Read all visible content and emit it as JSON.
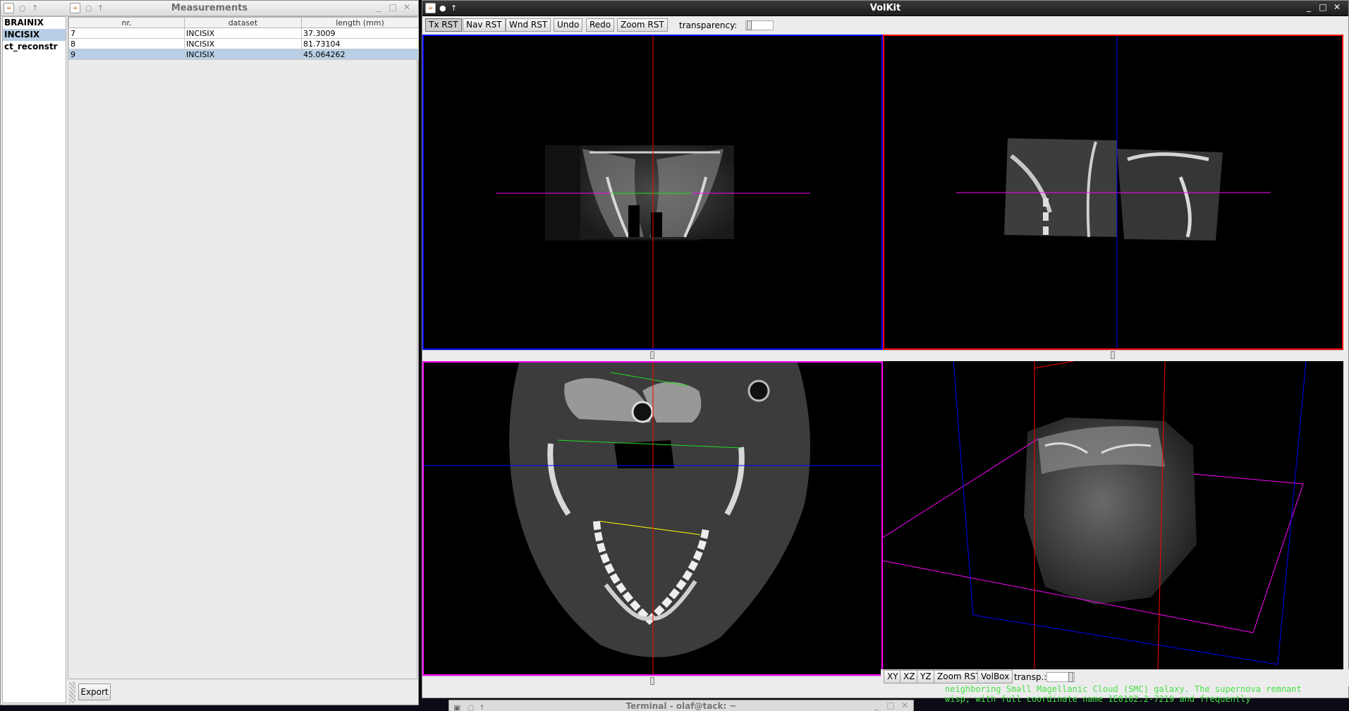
{
  "measurements_window": {
    "title": "Measurements",
    "datasets": [
      "BRAINIX",
      "INCISIX",
      "ct_reconstr"
    ],
    "selected_dataset": "INCISIX",
    "columns": [
      "nr.",
      "dataset",
      "length (mm)"
    ],
    "rows": [
      {
        "nr": "7",
        "dataset": "INCISIX",
        "length": "37.3009"
      },
      {
        "nr": "8",
        "dataset": "INCISIX",
        "length": "81.73104"
      },
      {
        "nr": "9",
        "dataset": "INCISIX",
        "length": "45.064262"
      }
    ],
    "selected_row_nr": "9",
    "export_label": "Export"
  },
  "volkit_window": {
    "title": "VolKit",
    "toolbar": {
      "tx_rst": "Tx RST",
      "nav_rst": "Nav RST",
      "wnd_rst": "Wnd RST",
      "undo": "Undo",
      "redo": "Redo",
      "zoom_rst": "Zoom RST",
      "transparency_label": "transparency:"
    },
    "view3d_toolbar": {
      "xy": "XY",
      "xz": "XZ",
      "yz": "YZ",
      "zoom_rst": "Zoom RST",
      "volbox": "VolBox",
      "transp_label": "transp.:"
    },
    "view_colors": {
      "axial_frame": "#0000ff",
      "sagittal_frame": "#ff0000",
      "coronal_frame": "#ff00ff",
      "crosshair_red": "#ff0000",
      "crosshair_blue": "#0000ff",
      "crosshair_magenta": "#ff00ff",
      "measure_green": "#22dd22",
      "measure_yellow": "#ffff00"
    }
  },
  "terminal": {
    "title": "Terminal - olaf@tack: ~",
    "lines": [
      "neighboring Small Magellanic Cloud (SMC) galaxy. The supernova remnant",
      "wisp, with full coordinate name 1E0102.2-7219 and frequently"
    ]
  }
}
